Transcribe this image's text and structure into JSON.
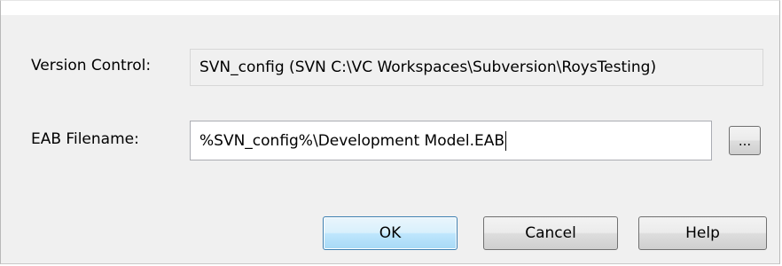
{
  "dialog": {
    "version_control_label": "Version Control:",
    "version_control_value": "SVN_config (SVN C:\\VC Workspaces\\Subversion\\RoysTesting)",
    "eab_filename_label": "EAB Filename:",
    "eab_filename_value": "%SVN_config%\\Development Model.EAB",
    "browse_label": "...",
    "ok_label": "OK",
    "cancel_label": "Cancel",
    "help_label": "Help"
  },
  "colors": {
    "dialog_background": "#f0f0f0",
    "primary_button_border": "#3c7fb1",
    "input_border": "#abadb3"
  }
}
